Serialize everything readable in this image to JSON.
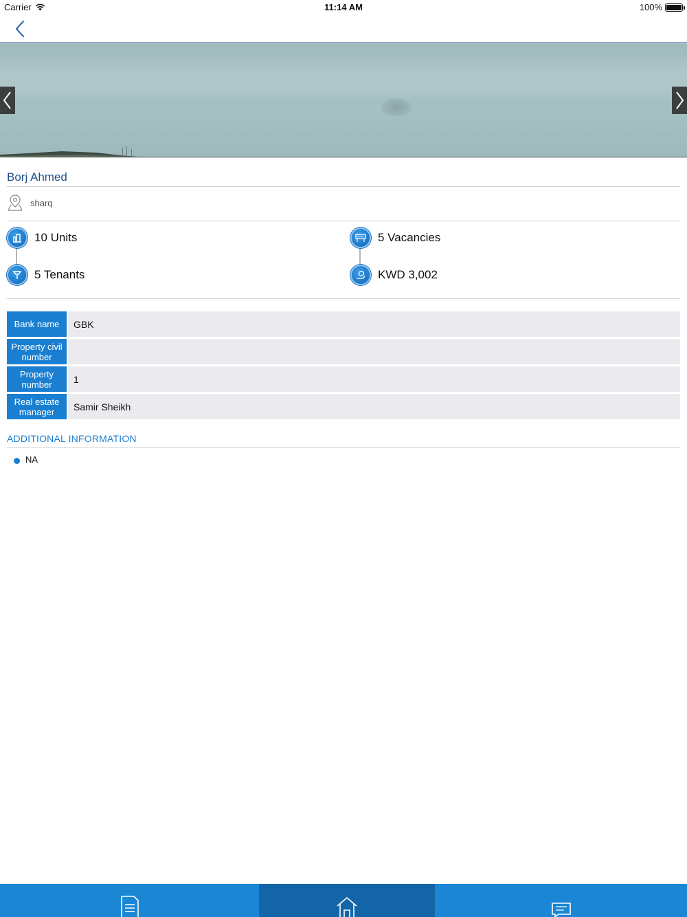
{
  "status_bar": {
    "carrier": "Carrier",
    "time": "11:14 AM",
    "battery": "100%"
  },
  "nav": {
    "back_icon": "chevron-left-icon"
  },
  "hero": {
    "prev_icon": "chevron-left-icon",
    "next_icon": "chevron-right-icon"
  },
  "property": {
    "title": "Borj Ahmed",
    "location": "sharq"
  },
  "stats": {
    "units": "10 Units",
    "vacancies": "5 Vacancies",
    "tenants": "5 Tenants",
    "rent": "KWD 3,002"
  },
  "details": [
    {
      "label": "Bank name",
      "value": "GBK"
    },
    {
      "label": "Property civil number",
      "value": ""
    },
    {
      "label": "Property number",
      "value": "1"
    },
    {
      "label": "Real estate manager",
      "value": "Samir Sheikh"
    }
  ],
  "additional": {
    "title": "ADDITIONAL INFORMATION",
    "items": [
      "NA"
    ]
  },
  "tabs": [
    {
      "icon": "document-icon",
      "active": false
    },
    {
      "icon": "home-icon",
      "active": true
    },
    {
      "icon": "chat-icon",
      "active": false
    }
  ],
  "colors": {
    "accent": "#1a7fd1",
    "title": "#1f4f8a",
    "tab_bar": "#1b87d4",
    "tab_active": "#1465a8"
  }
}
